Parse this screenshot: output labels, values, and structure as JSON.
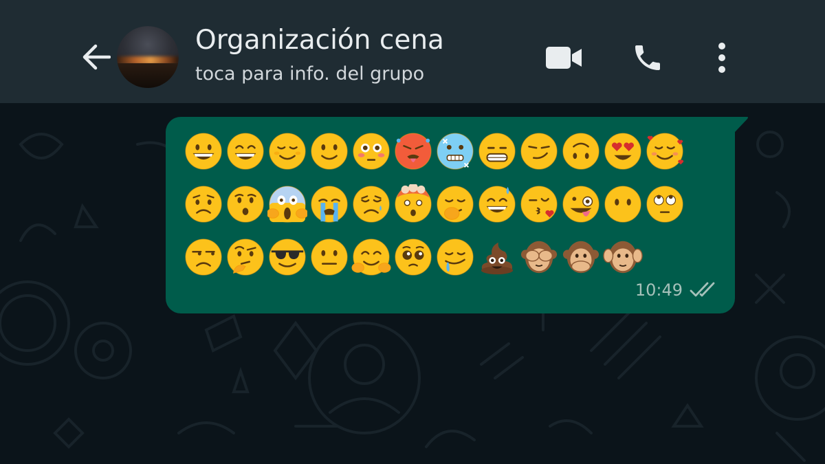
{
  "header": {
    "back_icon": "arrow-left-icon",
    "title": "Organización cena",
    "subtitle": "toca para info. del grupo",
    "actions": [
      "video-call-icon",
      "voice-call-icon",
      "more-vert-icon"
    ]
  },
  "message": {
    "direction": "outgoing",
    "time": "10:49",
    "status": "read-double-check",
    "emoji_rows": [
      [
        "grinning",
        "grin",
        "relieved",
        "slight-smile",
        "flushed",
        "hot-face",
        "cold-face",
        "grimacing",
        "smirk",
        "upside-down",
        "heart-eyes",
        "smiling-hearts"
      ],
      [
        "worried",
        "hushed",
        "scream",
        "sob",
        "disappointed-relieved",
        "exploding-head",
        "hand-over-mouth",
        "sweat-smile",
        "kissing-heart",
        "zany",
        "no-mouth",
        "eye-roll"
      ],
      [
        "unamused",
        "thinking",
        "sunglasses",
        "neutral",
        "hugging",
        "pleading",
        "drooling",
        "poop",
        "see-no-evil",
        "speak-no-evil",
        "hear-no-evil"
      ]
    ]
  },
  "colors": {
    "header_bg": "#1f2c33",
    "chat_bg": "#0b141a",
    "bubble_bg": "#005c4b",
    "header_text": "#e9edef",
    "meta_text": "#a6c1ba"
  }
}
